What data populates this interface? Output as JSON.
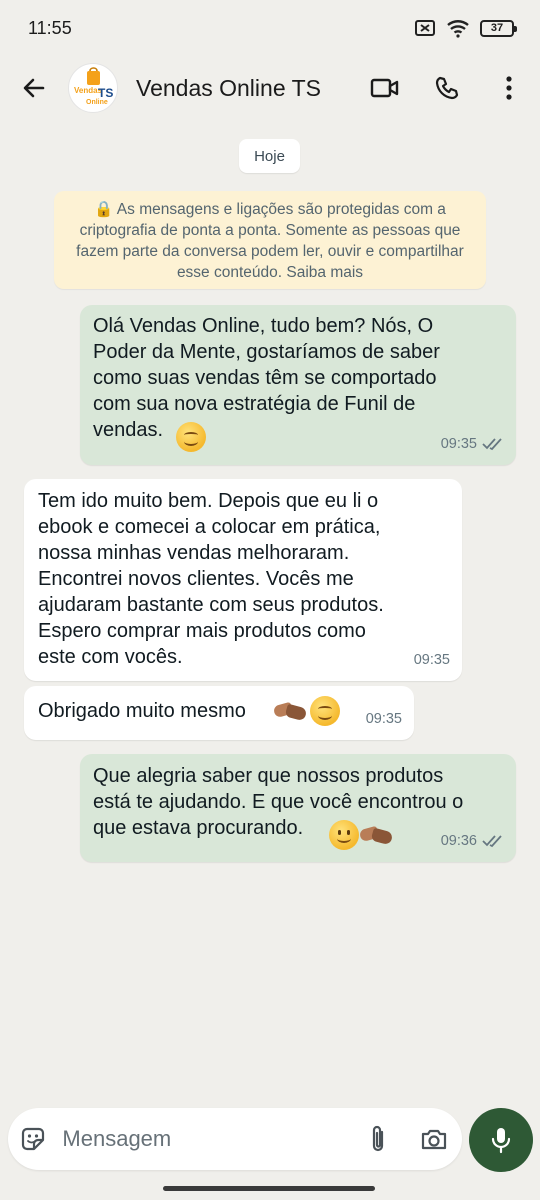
{
  "status_bar": {
    "time": "11:55",
    "battery": "37"
  },
  "header": {
    "contact_name": "Vendas Online TS",
    "avatar_logo": {
      "line1": "Vendas",
      "line2": "TS",
      "line3": "Online"
    }
  },
  "chat": {
    "date_label": "Hoje",
    "encryption_notice": "🔒 As mensagens e ligações são protegidas com a criptografia de ponta a ponta. Somente as pessoas que fazem parte da conversa podem ler, ouvir e compartilhar esse conteúdo. Saiba mais",
    "messages": [
      {
        "direction": "out",
        "text": "Olá Vendas Online, tudo bem? Nós, O\nPoder da Mente, gostaríamos de saber\ncomo suas vendas têm se comportado\ncom sua nova estratégia de Funil de\nvendas.",
        "emojis": [
          "smiling-face"
        ],
        "time": "09:35",
        "status": "read"
      },
      {
        "direction": "in",
        "text": "Tem ido muito bem. Depois que eu li o\nebook e comecei a colocar em prática,\nnossa minhas vendas melhoraram.\nEncontrei novos clientes. Vocês me\najudaram bastante com seus produtos.\nEspero comprar mais produtos como\neste com vocês.",
        "emojis": [],
        "time": "09:35"
      },
      {
        "direction": "in",
        "text": "Obrigado muito mesmo",
        "emojis": [
          "handshake",
          "smiling-face"
        ],
        "time": "09:35"
      },
      {
        "direction": "out",
        "text": "Que alegria saber que nossos produtos\nestá te ajudando. E que você encontrou o\nque estava procurando.",
        "emojis": [
          "slightly-smiling-face",
          "handshake"
        ],
        "time": "09:36",
        "status": "read"
      }
    ]
  },
  "composer": {
    "placeholder": "Mensagem"
  },
  "colors": {
    "background": "#f0efeb",
    "outgoing_bubble": "#d9e7d8",
    "incoming_bubble": "#ffffff",
    "notice_bubble": "#fdf2d4",
    "mic_button": "#2e5935"
  },
  "icons": [
    "back-arrow-icon",
    "video-call-icon",
    "phone-icon",
    "more-vert-icon",
    "sticker-icon",
    "attach-icon",
    "camera-icon",
    "mic-icon",
    "double-check-icon",
    "lock-icon"
  ]
}
